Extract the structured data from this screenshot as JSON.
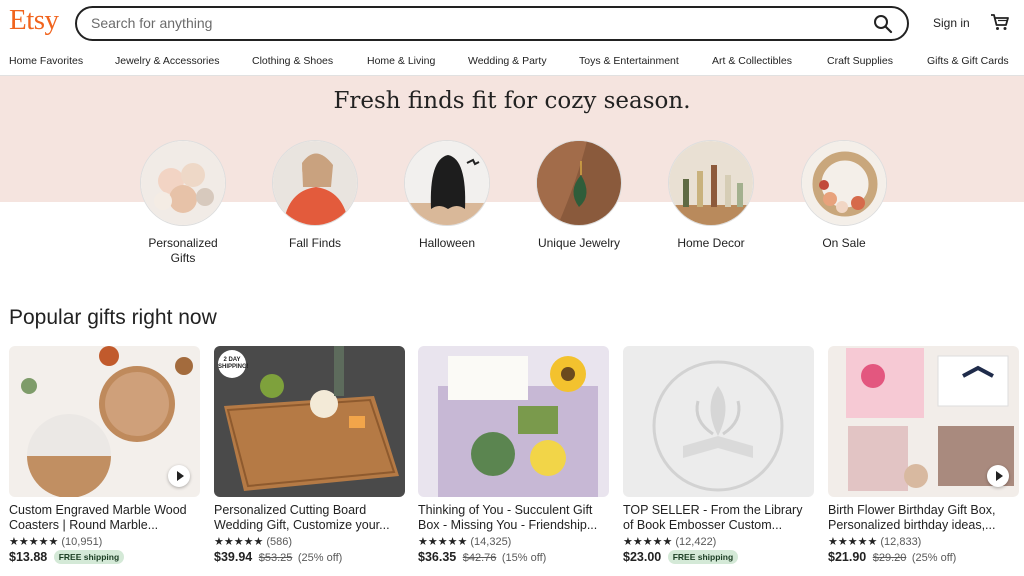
{
  "header": {
    "logo": "Etsy",
    "search_placeholder": "Search for anything",
    "signin_label": "Sign in"
  },
  "nav": [
    "Home Favorites",
    "Jewelry & Accessories",
    "Clothing & Shoes",
    "Home & Living",
    "Wedding & Party",
    "Toys & Entertainment",
    "Art & Collectibles",
    "Craft Supplies",
    "Gifts & Gift Cards"
  ],
  "hero": {
    "title": "Fresh finds fit for cozy season.",
    "categories": [
      {
        "label": "Personalized Gifts"
      },
      {
        "label": "Fall Finds"
      },
      {
        "label": "Halloween"
      },
      {
        "label": "Unique Jewelry"
      },
      {
        "label": "Home Decor"
      },
      {
        "label": "On Sale"
      }
    ]
  },
  "popular": {
    "title": "Popular gifts right now",
    "items": [
      {
        "title": "Custom Engraved Marble Wood Coasters | Round Marble...",
        "stars": "★★★★★",
        "reviews": "(10,951)",
        "price": "$13.88",
        "original": "",
        "discount": "",
        "badge": "FREE shipping"
      },
      {
        "title": "Personalized Cutting Board Wedding Gift, Customize your...",
        "stars": "★★★★★",
        "reviews": "(586)",
        "price": "$39.94",
        "original": "$53.25",
        "discount": "(25% off)",
        "badge": "",
        "tag": "2 DAY SHIPPING!"
      },
      {
        "title": "Thinking of You - Succulent Gift Box - Missing You - Friendship...",
        "stars": "★★★★★",
        "reviews": "(14,325)",
        "price": "$36.35",
        "original": "$42.76",
        "discount": "(15% off)",
        "badge": ""
      },
      {
        "title": "TOP SELLER - From the Library of Book Embosser Custom...",
        "stars": "★★★★★",
        "reviews": "(12,422)",
        "price": "$23.00",
        "original": "",
        "discount": "",
        "badge": "FREE shipping"
      },
      {
        "title": "Birth Flower Birthday Gift Box, Personalized birthday ideas,...",
        "stars": "★★★★★",
        "reviews": "(12,833)",
        "price": "$21.90",
        "original": "$29.20",
        "discount": "(25% off)",
        "badge": ""
      }
    ]
  },
  "colors": {
    "brand": "#f1641e",
    "hero_bg": "#f5e4df",
    "badge_bg": "#d4e9d7"
  }
}
